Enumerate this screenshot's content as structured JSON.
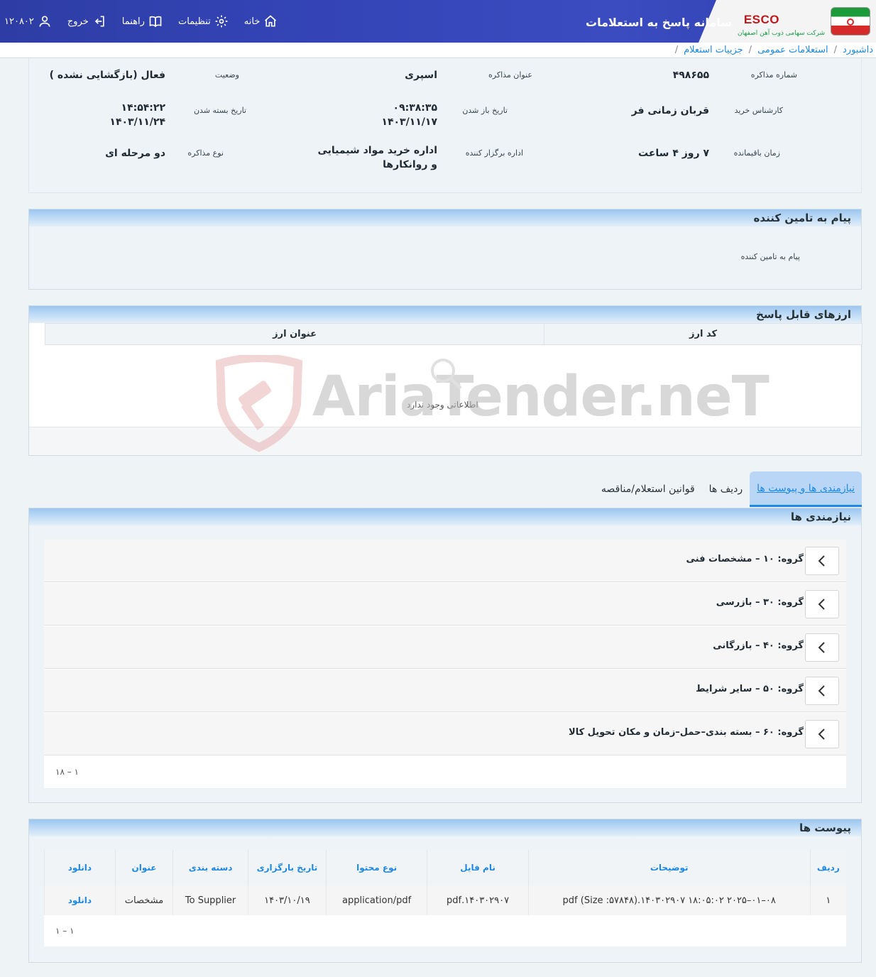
{
  "header": {
    "app_title": "سامانه پاسخ به استعلامات",
    "brand": "ESCO",
    "brand_sub": "شرکت سهامی ذوب آهن اصفهان",
    "nav": {
      "home": "خانه",
      "settings": "تنظیمات",
      "guide": "راهنما",
      "logout": "خروج",
      "user_id": "۱۲۰۸۰۲"
    }
  },
  "breadcrumb": [
    "داشبورد",
    "استعلامات عمومی",
    "جزییات استعلام"
  ],
  "info": {
    "negotiation_number_label": "شماره مذاکره",
    "negotiation_number": "۴۹۸۶۵۵",
    "negotiation_title_label": "عنوان مذاکره",
    "negotiation_title": "اسپری",
    "status_label": "وضعیت",
    "status": "فعال (بازگشایی نشده )",
    "buyer_label": "کارشناس خرید",
    "buyer": "قربان زمانی فر",
    "open_date_label": "تاریخ باز شدن",
    "open_time": "۰۹:۳۸:۳۵",
    "open_date": "۱۴۰۳/۱۱/۱۷",
    "close_date_label": "تاریخ بسته شدن",
    "close_time": "۱۴:۵۴:۲۲",
    "close_date": "۱۴۰۳/۱۱/۲۴",
    "remaining_label": "زمان باقیمانده",
    "remaining": "۷ روز ۴ ساعت",
    "organizer_label": "اداره برگزار کننده",
    "organizer_line1": "اداره خرید مواد شیمیایی",
    "organizer_line2": "و روانکارها",
    "type_label": "نوع مذاکره",
    "type": "دو مرحله ای"
  },
  "supplier_message": {
    "title": "پیام به تامین کننده",
    "body": "پیام به تامین کننده"
  },
  "currencies": {
    "title": "ارزهای قابل پاسخ",
    "columns": [
      "کد ارز",
      "عنوان ارز"
    ],
    "empty": "اطلاعاتی وجود ندارد"
  },
  "tabs": [
    "نیازمندی ها و پیوست ها",
    "ردیف ها",
    "قوانین استعلام/مناقصه"
  ],
  "requirements": {
    "title": "نیازمندی ها",
    "groups": [
      "گروه: ۱۰ – مشخصات فنی",
      "گروه: ۳۰ – بازرسی",
      "گروه: ۴۰ – بازرگانی",
      "گروه: ۵۰ – سایر شرایط",
      "گروه: ۶۰ – بسته بندی–حمل–زمان و مکان تحویل کالا"
    ],
    "pager": "۱ – ۱۸"
  },
  "attachments": {
    "title": "پیوست ها",
    "columns": [
      "ردیف",
      "توضیحات",
      "نام فایل",
      "نوع محتوا",
      "تاریخ بارگزاری",
      "دسته بندی",
      "عنوان",
      "دانلود"
    ],
    "rows": [
      [
        "۱",
        "۰۸–۰۱–۲۰۲۵ ۱۸:۰۵:۰۲ ۱۴۰۳۰۲۹۰۷.(Size :۵۷۸۴۸) pdf",
        "۱۴۰۳۰۲۹۰۷.pdf",
        "application/pdf",
        "۱۴۰۳/۱۰/۱۹",
        "To Supplier",
        "مشخصات",
        "دانلود"
      ]
    ],
    "pager": "۱ – ۱"
  },
  "watermark": "AriaTender.neT"
}
